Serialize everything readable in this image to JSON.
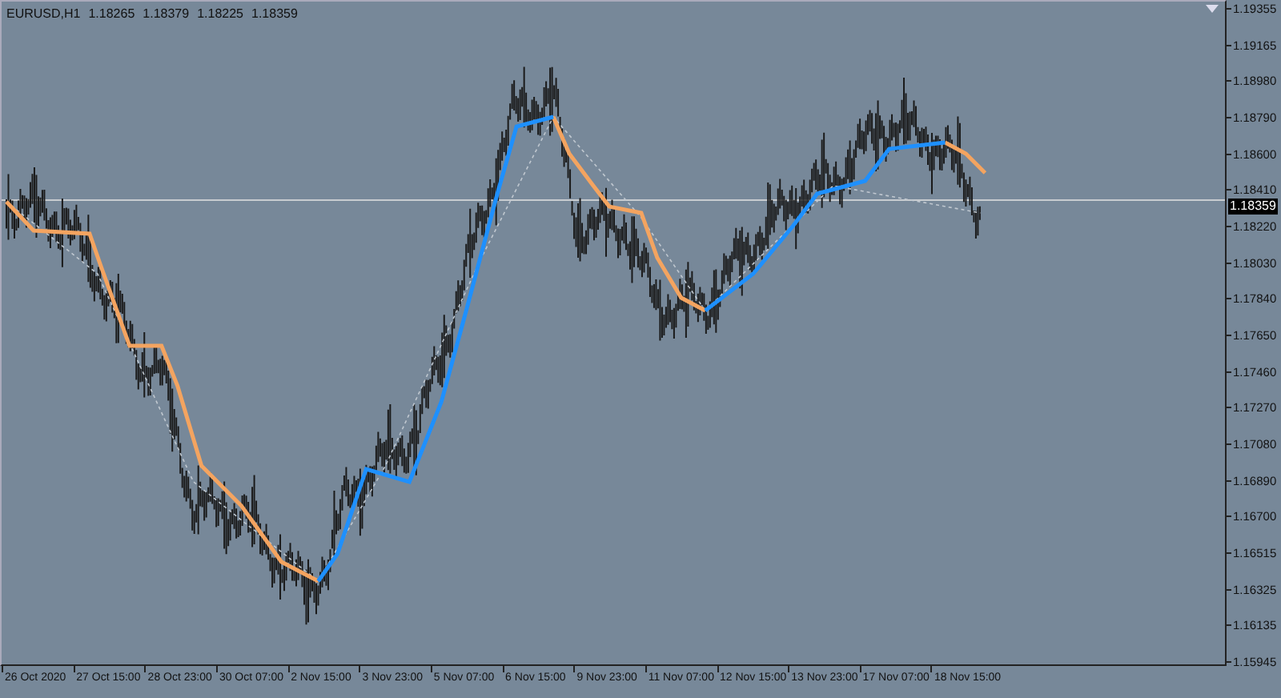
{
  "chart": {
    "symbol": "EURUSD,H1",
    "ohlc": [
      "1.18265",
      "1.18379",
      "1.18225",
      "1.18359"
    ]
  },
  "price_axis": {
    "labels": [
      "1.19355",
      "1.19165",
      "1.18980",
      "1.18790",
      "1.18600",
      "1.18410",
      "1.18220",
      "1.18030",
      "1.17840",
      "1.17650",
      "1.17460",
      "1.17270",
      "1.17080",
      "1.16890",
      "1.16700",
      "1.16515",
      "1.16325",
      "1.16135",
      "1.15945"
    ],
    "current_price": "1.18359"
  },
  "time_axis": {
    "labels": [
      "26 Oct 2020",
      "27 Oct 15:00",
      "28 Oct 23:00",
      "30 Oct 07:00",
      "2 Nov 15:00",
      "3 Nov 23:00",
      "5 Nov 07:00",
      "6 Nov 15:00",
      "9 Nov 23:00",
      "11 Nov 07:00",
      "12 Nov 15:00",
      "13 Nov 23:00",
      "17 Nov 07:00",
      "18 Nov 15:00"
    ]
  }
}
